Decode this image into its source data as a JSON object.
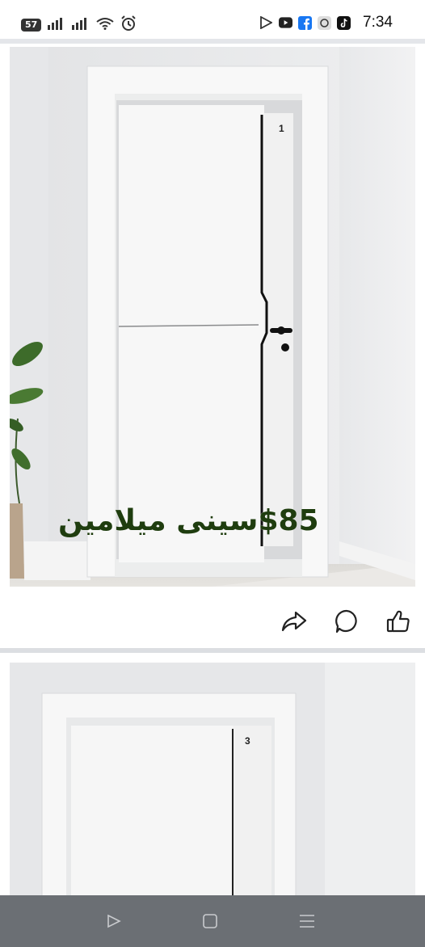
{
  "status_bar": {
    "time": "7:34",
    "notification_count": "57",
    "app_icons": [
      "play-store-icon",
      "youtube-icon",
      "facebook-icon",
      "vpn-icon",
      "tiktok-icon"
    ],
    "system_icons": [
      "signal-icon",
      "signal-icon",
      "wifi-icon",
      "alarm-icon"
    ]
  },
  "post1": {
    "caption": "$85سينى ميلامين",
    "door_number": "1",
    "caption_color": "#1f3d0f"
  },
  "post_actions": [
    "share-icon",
    "comment-icon",
    "like-icon"
  ],
  "post2": {
    "door_number": "3"
  },
  "nav_bar": [
    "back-icon",
    "home-icon",
    "recents-icon"
  ],
  "colors": {
    "nav_bar": "#6b6f74",
    "divider": "#dcdee2",
    "wall": "#e9eaec",
    "door": "#f7f7f7"
  }
}
